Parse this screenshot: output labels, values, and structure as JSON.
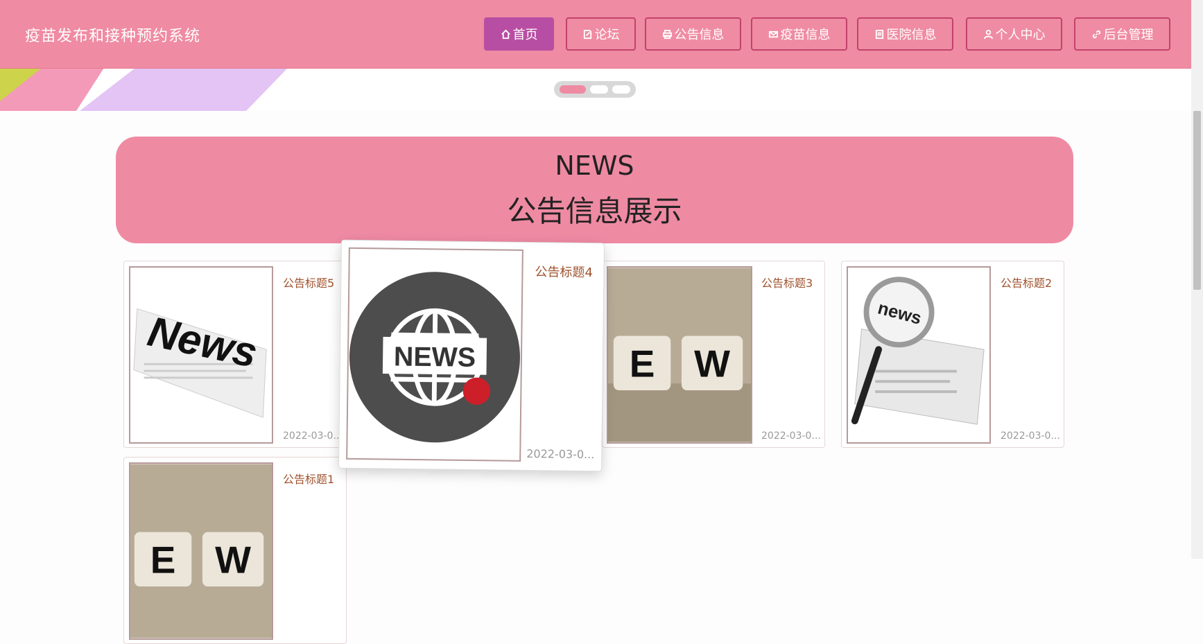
{
  "site": {
    "title": "疫苗发布和接种预约系统"
  },
  "nav": [
    {
      "label": "首页",
      "icon": "home-icon",
      "active": true
    },
    {
      "label": "论坛",
      "icon": "edit-icon"
    },
    {
      "label": "公告信息",
      "icon": "print-icon"
    },
    {
      "label": "疫苗信息",
      "icon": "mail-icon"
    },
    {
      "label": "医院信息",
      "icon": "document-icon"
    },
    {
      "label": "个人中心",
      "icon": "user-icon"
    },
    {
      "label": "后台管理",
      "icon": "link-icon"
    }
  ],
  "section": {
    "title_en": "NEWS",
    "title_cn": "公告信息展示"
  },
  "cards": [
    {
      "title": "公告标题5",
      "date": "2022-03-0...",
      "image": "newspaper-news"
    },
    {
      "title": "公告标题4",
      "date": "2022-03-0...",
      "image": "globe-news"
    },
    {
      "title": "公告标题3",
      "date": "2022-03-0...",
      "image": "letter-cubes-news"
    },
    {
      "title": "公告标题2",
      "date": "2022-03-0...",
      "image": "magnifier-news"
    },
    {
      "title": "公告标题1",
      "date": "",
      "image": "letter-cubes-news"
    }
  ],
  "colors": {
    "header": "#ef8ba2",
    "active_nav": "#b84ea3",
    "title_text": "#a0522d"
  }
}
